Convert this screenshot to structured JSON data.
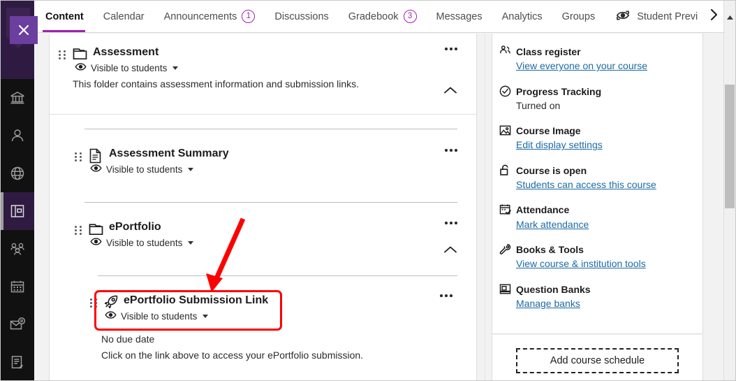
{
  "window": {
    "close_label": "×"
  },
  "leftnav": {
    "items": [
      {
        "name": "institution-icon",
        "label": "Institution"
      },
      {
        "name": "profile-icon",
        "label": "Profile"
      },
      {
        "name": "globe-icon",
        "label": "Institution Page"
      },
      {
        "name": "courses-icon",
        "label": "Courses",
        "active": true
      },
      {
        "name": "groups-icon",
        "label": "Organizations"
      },
      {
        "name": "calendar-icon",
        "label": "Calendar"
      },
      {
        "name": "messages-icon",
        "label": "Messages"
      },
      {
        "name": "grades-icon",
        "label": "Grades"
      }
    ]
  },
  "tabs": [
    {
      "label": "Content",
      "badge": null,
      "active": true
    },
    {
      "label": "Calendar",
      "badge": null,
      "active": false
    },
    {
      "label": "Announcements",
      "badge": "1",
      "active": false
    },
    {
      "label": "Discussions",
      "badge": null,
      "active": false
    },
    {
      "label": "Gradebook",
      "badge": "3",
      "active": false
    },
    {
      "label": "Messages",
      "badge": null,
      "active": false
    },
    {
      "label": "Analytics",
      "badge": null,
      "active": false
    },
    {
      "label": "Groups",
      "badge": null,
      "active": false
    }
  ],
  "student_preview": {
    "label": "Student Previ",
    "icon": "student-preview-icon"
  },
  "tab_overflow": {
    "icon": "chevron-right-icon"
  },
  "content": {
    "items": [
      {
        "title": "Assessment",
        "icon": "folder-icon",
        "visibility": "Visible to students",
        "description": "This folder contains assessment information and submission links.",
        "collapse_icon": "chevron-up-icon",
        "menu_icon": "kebab-menu-icon"
      },
      {
        "title": "Assessment Summary",
        "icon": "document-icon",
        "visibility": "Visible to students",
        "description": "",
        "menu_icon": "kebab-menu-icon"
      },
      {
        "title": "ePortfolio",
        "icon": "folder-icon",
        "visibility": "Visible to students",
        "description": "",
        "collapse_icon": "chevron-up-icon",
        "menu_icon": "kebab-menu-icon"
      },
      {
        "title": "ePortfolio Submission Link",
        "icon": "lti-rocket-icon",
        "visibility": "Visible to students",
        "due_date": "No due date",
        "description": "Click on the link above to access your ePortfolio submission.",
        "menu_icon": "kebab-menu-icon",
        "highlighted": true
      }
    ]
  },
  "details_panel": {
    "items": [
      {
        "icon": "class-register-icon",
        "title": "Class register",
        "link": "View everyone on your course",
        "value": null
      },
      {
        "icon": "progress-tracking-icon",
        "title": "Progress Tracking",
        "link": null,
        "value": "Turned on"
      },
      {
        "icon": "course-image-icon",
        "title": "Course Image",
        "link": "Edit display settings",
        "value": null
      },
      {
        "icon": "unlock-icon",
        "title": "Course is open",
        "link": "Students can access this course",
        "value": null
      },
      {
        "icon": "attendance-icon",
        "title": "Attendance",
        "link": "Mark attendance",
        "value": null
      },
      {
        "icon": "tools-icon",
        "title": "Books & Tools",
        "link": "View course & institution tools",
        "value": null
      },
      {
        "icon": "question-banks-icon",
        "title": "Question Banks",
        "link": "Manage banks",
        "value": null
      }
    ],
    "add_schedule_label": "Add course schedule"
  },
  "colors": {
    "accent_purple": "#a020b0",
    "nav_purple": "#2f1b42",
    "close_purple": "#6b3fa0",
    "link_blue": "#1c6aa5",
    "annotation_red": "#ff0000"
  }
}
